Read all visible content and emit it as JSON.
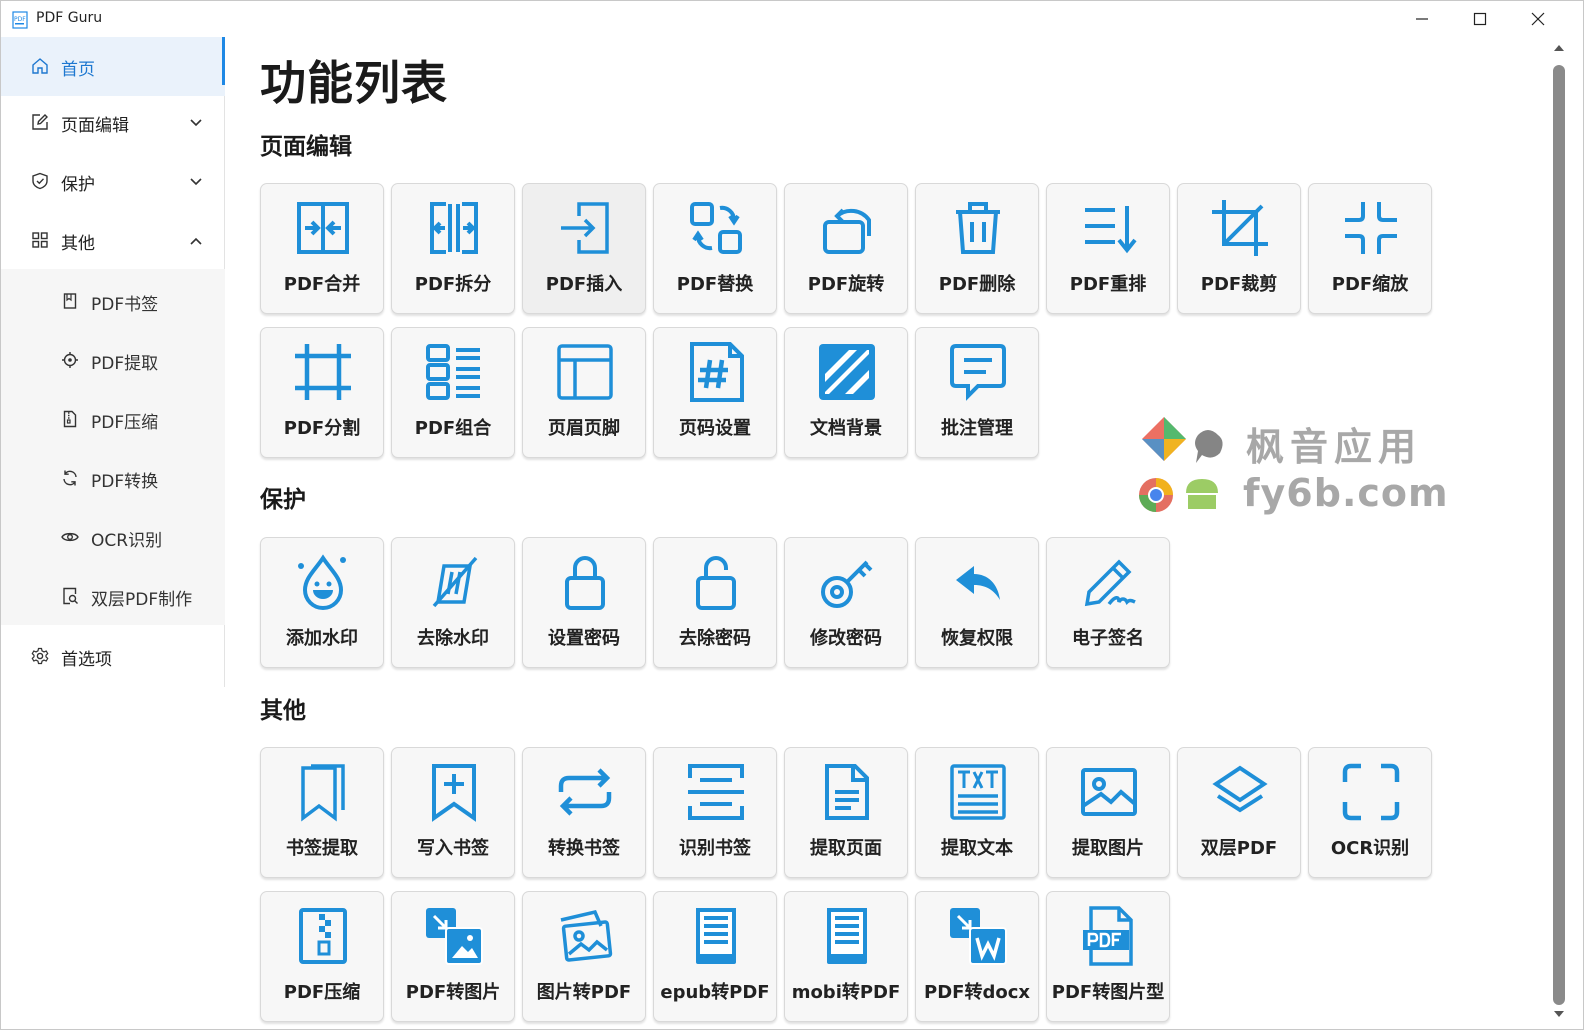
{
  "window": {
    "title": "PDF Guru",
    "app_icon_text": "PDF"
  },
  "sidebar": {
    "items": [
      {
        "label": "首页",
        "icon": "home-icon",
        "active": true
      },
      {
        "label": "页面编辑",
        "icon": "edit-icon",
        "expanded": false
      },
      {
        "label": "保护",
        "icon": "shield-icon",
        "expanded": false
      },
      {
        "label": "其他",
        "icon": "grid-icon",
        "expanded": true
      }
    ],
    "sub_items": [
      {
        "label": "PDF书签",
        "icon": "bookmark-icon"
      },
      {
        "label": "PDF提取",
        "icon": "target-icon"
      },
      {
        "label": "PDF压缩",
        "icon": "zip-icon"
      },
      {
        "label": "PDF转换",
        "icon": "refresh-icon"
      },
      {
        "label": "OCR识别",
        "icon": "eye-icon"
      },
      {
        "label": "双层PDF制作",
        "icon": "doc-search-icon"
      }
    ],
    "preferences": {
      "label": "首选项",
      "icon": "gear-icon"
    }
  },
  "main": {
    "title": "功能列表",
    "sections": [
      {
        "title": "页面编辑",
        "tiles": [
          {
            "label": "PDF合并",
            "icon": "merge-icon"
          },
          {
            "label": "PDF拆分",
            "icon": "split-icon"
          },
          {
            "label": "PDF插入",
            "icon": "insert-icon"
          },
          {
            "label": "PDF替换",
            "icon": "replace-icon"
          },
          {
            "label": "PDF旋转",
            "icon": "rotate-icon"
          },
          {
            "label": "PDF删除",
            "icon": "trash-icon"
          },
          {
            "label": "PDF重排",
            "icon": "reorder-icon"
          },
          {
            "label": "PDF裁剪",
            "icon": "crop-icon"
          },
          {
            "label": "PDF缩放",
            "icon": "shrink-icon"
          },
          {
            "label": "PDF分割",
            "icon": "frame-icon"
          },
          {
            "label": "PDF组合",
            "icon": "list-icon"
          },
          {
            "label": "页眉页脚",
            "icon": "layout-icon"
          },
          {
            "label": "页码设置",
            "icon": "page-number-icon"
          },
          {
            "label": "文档背景",
            "icon": "background-icon"
          },
          {
            "label": "批注管理",
            "icon": "comment-icon"
          }
        ]
      },
      {
        "title": "保护",
        "tiles": [
          {
            "label": "添加水印",
            "icon": "watermark-icon"
          },
          {
            "label": "去除水印",
            "icon": "remove-watermark-icon"
          },
          {
            "label": "设置密码",
            "icon": "lock-icon"
          },
          {
            "label": "去除密码",
            "icon": "unlock-icon"
          },
          {
            "label": "修改密码",
            "icon": "key-icon"
          },
          {
            "label": "恢复权限",
            "icon": "undo-icon"
          },
          {
            "label": "电子签名",
            "icon": "pen-icon"
          }
        ]
      },
      {
        "title": "其他",
        "tiles": [
          {
            "label": "书签提取",
            "icon": "bookmarks-icon"
          },
          {
            "label": "写入书签",
            "icon": "bookmark-add-icon"
          },
          {
            "label": "转换书签",
            "icon": "convert-icon"
          },
          {
            "label": "识别书签",
            "icon": "scan-icon"
          },
          {
            "label": "提取页面",
            "icon": "file-text-icon"
          },
          {
            "label": "提取文本",
            "icon": "txt-icon"
          },
          {
            "label": "提取图片",
            "icon": "image-icon"
          },
          {
            "label": "双层PDF",
            "icon": "layers-icon"
          },
          {
            "label": "OCR识别",
            "icon": "ocr-frame-icon"
          },
          {
            "label": "PDF压缩",
            "icon": "zip-file-icon"
          },
          {
            "label": "PDF转图片",
            "icon": "pdf-to-image-icon"
          },
          {
            "label": "图片转PDF",
            "icon": "images-icon"
          },
          {
            "label": "epub转PDF",
            "icon": "epub-icon"
          },
          {
            "label": "mobi转PDF",
            "icon": "mobi-icon"
          },
          {
            "label": "PDF转docx",
            "icon": "word-icon"
          },
          {
            "label": "PDF转图片型",
            "icon": "pdf-file-icon"
          }
        ]
      }
    ]
  },
  "watermark": {
    "line1": "枫音应用",
    "line2": "fy6b.com"
  },
  "colors": {
    "accent": "#1e88e5",
    "icon": "#1f8fd8",
    "active_bg": "#eaf2fb"
  }
}
